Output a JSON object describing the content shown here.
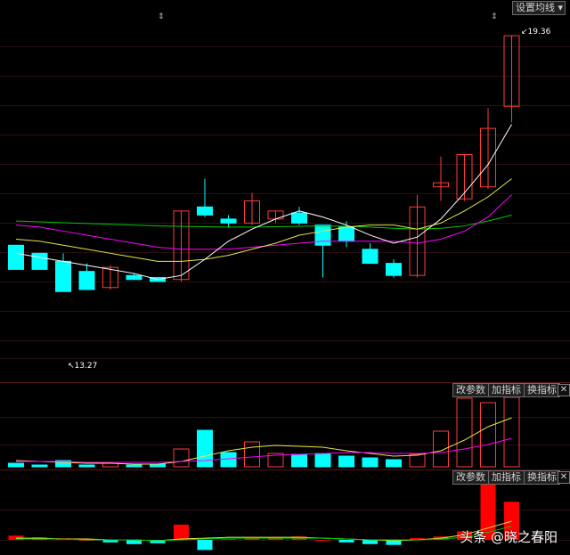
{
  "header": {
    "ma_setting_button": "设置均线",
    "dropdown_arrow": "▾"
  },
  "price_panel": {
    "high_label": "19.36",
    "low_label": "13.27"
  },
  "indicator_panel_1": {
    "buttons": [
      "改参数",
      "加指标",
      "换指标"
    ],
    "close_label": "✕"
  },
  "indicator_panel_2": {
    "buttons": [
      "改参数",
      "加指标",
      "换指标"
    ],
    "close_label": "✕"
  },
  "watermark": "头条 @晓之春阳",
  "colors": {
    "up": "#ff3b3b",
    "down": "#00ffff",
    "ma5": "#ffffff",
    "ma10": "#e6e64a",
    "ma20": "#ff00ff",
    "ma60": "#00c800",
    "macd_up": "#ff0000",
    "background": "#000000"
  },
  "candles": [
    {
      "o": 16.3,
      "h": 16.3,
      "l": 15.75,
      "c": 15.7
    },
    {
      "o": 16.1,
      "h": 16.1,
      "l": 15.8,
      "c": 15.7
    },
    {
      "o": 15.9,
      "h": 16.1,
      "l": 15.3,
      "c": 15.15
    },
    {
      "o": 15.65,
      "h": 15.85,
      "l": 15.3,
      "c": 15.2
    },
    {
      "o": 15.25,
      "h": 15.8,
      "l": 15.2,
      "c": 15.75
    },
    {
      "o": 15.55,
      "h": 15.6,
      "l": 15.45,
      "c": 15.45
    },
    {
      "o": 15.5,
      "h": 15.5,
      "l": 15.4,
      "c": 15.4
    },
    {
      "o": 15.45,
      "h": 17.15,
      "l": 15.4,
      "c": 17.15
    },
    {
      "o": 17.25,
      "h": 17.95,
      "l": 17.0,
      "c": 17.05
    },
    {
      "o": 16.95,
      "h": 17.05,
      "l": 16.75,
      "c": 16.85
    },
    {
      "o": 16.85,
      "h": 17.6,
      "l": 16.8,
      "c": 17.4
    },
    {
      "o": 16.95,
      "h": 17.1,
      "l": 16.85,
      "c": 17.15
    },
    {
      "o": 17.1,
      "h": 17.25,
      "l": 16.8,
      "c": 16.85
    },
    {
      "o": 16.8,
      "h": 16.8,
      "l": 15.5,
      "c": 16.3
    },
    {
      "o": 16.75,
      "h": 16.9,
      "l": 16.25,
      "c": 16.4
    },
    {
      "o": 16.2,
      "h": 16.35,
      "l": 15.9,
      "c": 15.85
    },
    {
      "o": 15.85,
      "h": 15.95,
      "l": 15.5,
      "c": 15.55
    },
    {
      "o": 15.55,
      "h": 17.55,
      "l": 15.5,
      "c": 17.25
    },
    {
      "o": 17.75,
      "h": 18.5,
      "l": 17.4,
      "c": 17.85
    },
    {
      "o": 17.45,
      "h": 18.55,
      "l": 17.4,
      "c": 18.55
    },
    {
      "o": 17.75,
      "h": 19.7,
      "l": 17.7,
      "c": 19.2
    },
    {
      "o": 19.75,
      "h": 20.9,
      "l": 19.35,
      "c": 21.5
    }
  ],
  "ma_lines": {
    "ma5": [
      16.1,
      16.0,
      15.9,
      15.8,
      15.7,
      15.6,
      15.45,
      15.55,
      15.95,
      16.4,
      16.7,
      16.95,
      17.15,
      17.0,
      16.8,
      16.55,
      16.35,
      16.5,
      16.95,
      17.6,
      18.3,
      19.3
    ],
    "ma10": [
      16.45,
      16.4,
      16.3,
      16.2,
      16.1,
      16.0,
      15.9,
      15.9,
      15.95,
      16.05,
      16.2,
      16.35,
      16.55,
      16.65,
      16.75,
      16.8,
      16.8,
      16.7,
      16.85,
      17.15,
      17.5,
      17.95
    ],
    "ma20": [
      16.8,
      16.75,
      16.65,
      16.55,
      16.45,
      16.35,
      16.25,
      16.2,
      16.2,
      16.2,
      16.25,
      16.3,
      16.35,
      16.4,
      16.4,
      16.4,
      16.4,
      16.35,
      16.45,
      16.65,
      17.0,
      17.55
    ],
    "ma60": [
      16.9,
      16.88,
      16.86,
      16.84,
      16.82,
      16.8,
      16.78,
      16.77,
      16.76,
      16.75,
      16.75,
      16.76,
      16.77,
      16.78,
      16.77,
      16.75,
      16.72,
      16.7,
      16.72,
      16.78,
      16.9,
      17.05
    ]
  },
  "volume": [
    4,
    2,
    7,
    2,
    5,
    2,
    3,
    20,
    41,
    16,
    28,
    15,
    14,
    15,
    12,
    10,
    8,
    14,
    40,
    77,
    72,
    78
  ],
  "volume_ma": [
    [
      7,
      6,
      5,
      4,
      4,
      3,
      3,
      6,
      12,
      18,
      22,
      24,
      23,
      22,
      18,
      15,
      12,
      13,
      18,
      30,
      45,
      55
    ],
    [
      6,
      6,
      6,
      5,
      5,
      5,
      5,
      6,
      7,
      9,
      11,
      13,
      14,
      15,
      16,
      16,
      15,
      15,
      16,
      20,
      25,
      32
    ]
  ],
  "macd": [
    0.5,
    0.3,
    0.2,
    0.0,
    -0.3,
    -0.5,
    -0.4,
    1.8,
    -1.2,
    0.1,
    0.2,
    0.3,
    0.4,
    0.0,
    -0.3,
    -0.5,
    -0.6,
    0.2,
    0.4,
    1.0,
    7.0,
    4.5
  ],
  "macd_lines": [
    [
      0.2,
      0.2,
      0.1,
      0.1,
      0.0,
      0.0,
      -0.1,
      0.1,
      0.2,
      0.3,
      0.3,
      0.3,
      0.3,
      0.2,
      0.1,
      0.0,
      -0.1,
      0.0,
      0.2,
      0.6,
      1.4,
      2.2
    ],
    [
      0.1,
      0.1,
      0.1,
      0.0,
      0.0,
      0.0,
      -0.1,
      0.0,
      0.1,
      0.2,
      0.2,
      0.2,
      0.2,
      0.2,
      0.1,
      0.0,
      0.0,
      0.0,
      0.1,
      0.3,
      0.9,
      1.6
    ]
  ]
}
